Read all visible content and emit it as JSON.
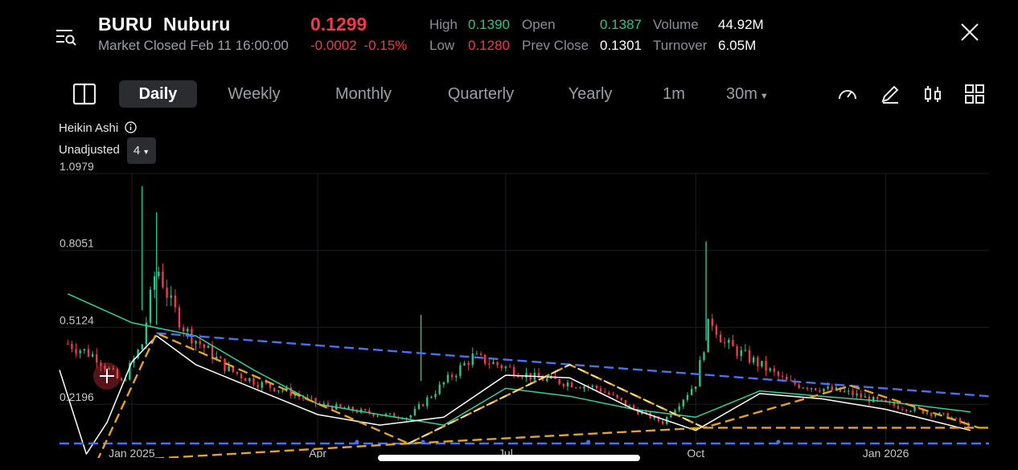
{
  "header": {
    "ticker": "BURU",
    "name": "Nuburu",
    "price": "0.1299",
    "status": "Market Closed Feb 11 16:00:00",
    "change": "-0.0002",
    "change_pct": "-0.15%",
    "stats": {
      "high_label": "High",
      "high": "0.1390",
      "low_label": "Low",
      "low": "0.1280",
      "open_label": "Open",
      "open": "0.1387",
      "prev_close_label": "Prev Close",
      "prev_close": "0.1301",
      "volume_label": "Volume",
      "volume": "44.92M",
      "turnover_label": "Turnover",
      "turnover": "6.05M"
    }
  },
  "tabs": [
    "Daily",
    "Weekly",
    "Monthly",
    "Quarterly",
    "Yearly",
    "1m",
    "30m"
  ],
  "active_tab": "Daily",
  "tools": [
    "gauge-icon",
    "pen-icon",
    "indicator-icon",
    "grid-icon"
  ],
  "options": {
    "chart_style": "Heikin Ashi",
    "adjust": "Unadjusted",
    "count": "4"
  },
  "colors": {
    "up": "#2bc48a",
    "down": "#f0394b",
    "price": "#f0394b",
    "bg": "#000000",
    "ma_green": "#2ed49a",
    "ma_white": "#ffffff",
    "trend_blue": "#4a72f0",
    "trend_gold": "#e0a526",
    "trend_cream": "#f3d98a"
  },
  "chart_data": {
    "type": "candlestick",
    "style": "Heikin Ashi",
    "ylim": [
      0.07,
      1.0979
    ],
    "y_ticks": [
      "1.0979",
      "0.8051",
      "0.5124",
      "0.2196"
    ],
    "x_ticks": [
      "Jan 2025",
      "Apr",
      "Jul",
      "Oct",
      "Jan 2026"
    ],
    "grid": true,
    "series": [
      {
        "type": "candles",
        "x": [
          "2024-12-01",
          "2024-12-15",
          "2024-12-27",
          "2025-01-06",
          "2025-01-13",
          "2025-01-20",
          "2025-01-27",
          "2025-02-03",
          "2025-02-10",
          "2025-02-17",
          "2025-03-03",
          "2025-03-17",
          "2025-04-01",
          "2025-04-15",
          "2025-05-01",
          "2025-05-15",
          "2025-06-01",
          "2025-06-15",
          "2025-07-01",
          "2025-07-15",
          "2025-08-01",
          "2025-08-15",
          "2025-09-01",
          "2025-09-15",
          "2025-10-01",
          "2025-10-08",
          "2025-10-15",
          "2025-11-01",
          "2025-11-15",
          "2025-12-01",
          "2025-12-15",
          "2026-01-01",
          "2026-01-15",
          "2026-02-01",
          "2026-02-11"
        ],
        "close": [
          0.45,
          0.4,
          0.3,
          0.45,
          0.75,
          0.6,
          0.5,
          0.45,
          0.4,
          0.35,
          0.3,
          0.27,
          0.22,
          0.2,
          0.18,
          0.17,
          0.3,
          0.4,
          0.36,
          0.32,
          0.3,
          0.28,
          0.2,
          0.15,
          0.3,
          0.55,
          0.45,
          0.37,
          0.3,
          0.28,
          0.26,
          0.22,
          0.2,
          0.17,
          0.13
        ]
      },
      {
        "type": "line",
        "color": "green",
        "x": [
          "2024-12-01",
          "2025-01-01",
          "2025-02-01",
          "2025-03-01",
          "2025-04-01",
          "2025-05-01",
          "2025-06-01",
          "2025-07-01",
          "2025-08-01",
          "2025-09-01",
          "2025-10-01",
          "2025-11-01",
          "2025-12-01",
          "2026-01-01",
          "2026-02-11"
        ],
        "y": [
          0.64,
          0.53,
          0.48,
          0.35,
          0.22,
          0.18,
          0.14,
          0.28,
          0.25,
          0.2,
          0.17,
          0.27,
          0.25,
          0.23,
          0.19
        ]
      },
      {
        "type": "line",
        "color": "white",
        "x": [
          "2024-11-27",
          "2024-12-10",
          "2024-12-20",
          "2025-01-01",
          "2025-01-13",
          "2025-02-01",
          "2025-03-01",
          "2025-04-01",
          "2025-05-01",
          "2025-06-01",
          "2025-07-01",
          "2025-08-01",
          "2025-09-01",
          "2025-10-01",
          "2025-11-01",
          "2025-12-01",
          "2026-01-01",
          "2026-02-11"
        ],
        "y": [
          0.35,
          0.03,
          0.15,
          0.38,
          0.48,
          0.37,
          0.28,
          0.18,
          0.14,
          0.17,
          0.33,
          0.32,
          0.2,
          0.12,
          0.26,
          0.24,
          0.2,
          0.12
        ]
      }
    ],
    "trendlines": [
      {
        "color": "blue",
        "style": "dashed",
        "x": [
          "2024-11-27",
          "2026-02-20"
        ],
        "y": [
          0.07,
          0.07
        ]
      },
      {
        "color": "blue",
        "style": "dashed",
        "x": [
          "2025-01-13",
          "2026-02-20"
        ],
        "y": [
          0.49,
          0.25
        ]
      },
      {
        "color": "gold",
        "style": "dashed",
        "x": [
          "2024-12-15",
          "2025-01-13",
          "2025-05-15",
          "2025-08-01",
          "2025-10-05",
          "2025-12-15",
          "2026-02-15"
        ],
        "y": [
          0.0,
          0.49,
          0.07,
          0.37,
          0.13,
          0.29,
          0.13
        ]
      },
      {
        "color": "gold",
        "style": "dashed",
        "x": [
          "2024-12-15",
          "2025-05-15",
          "2025-10-05",
          "2026-02-20"
        ],
        "y": [
          0.0,
          0.07,
          0.13,
          0.13
        ]
      }
    ]
  }
}
